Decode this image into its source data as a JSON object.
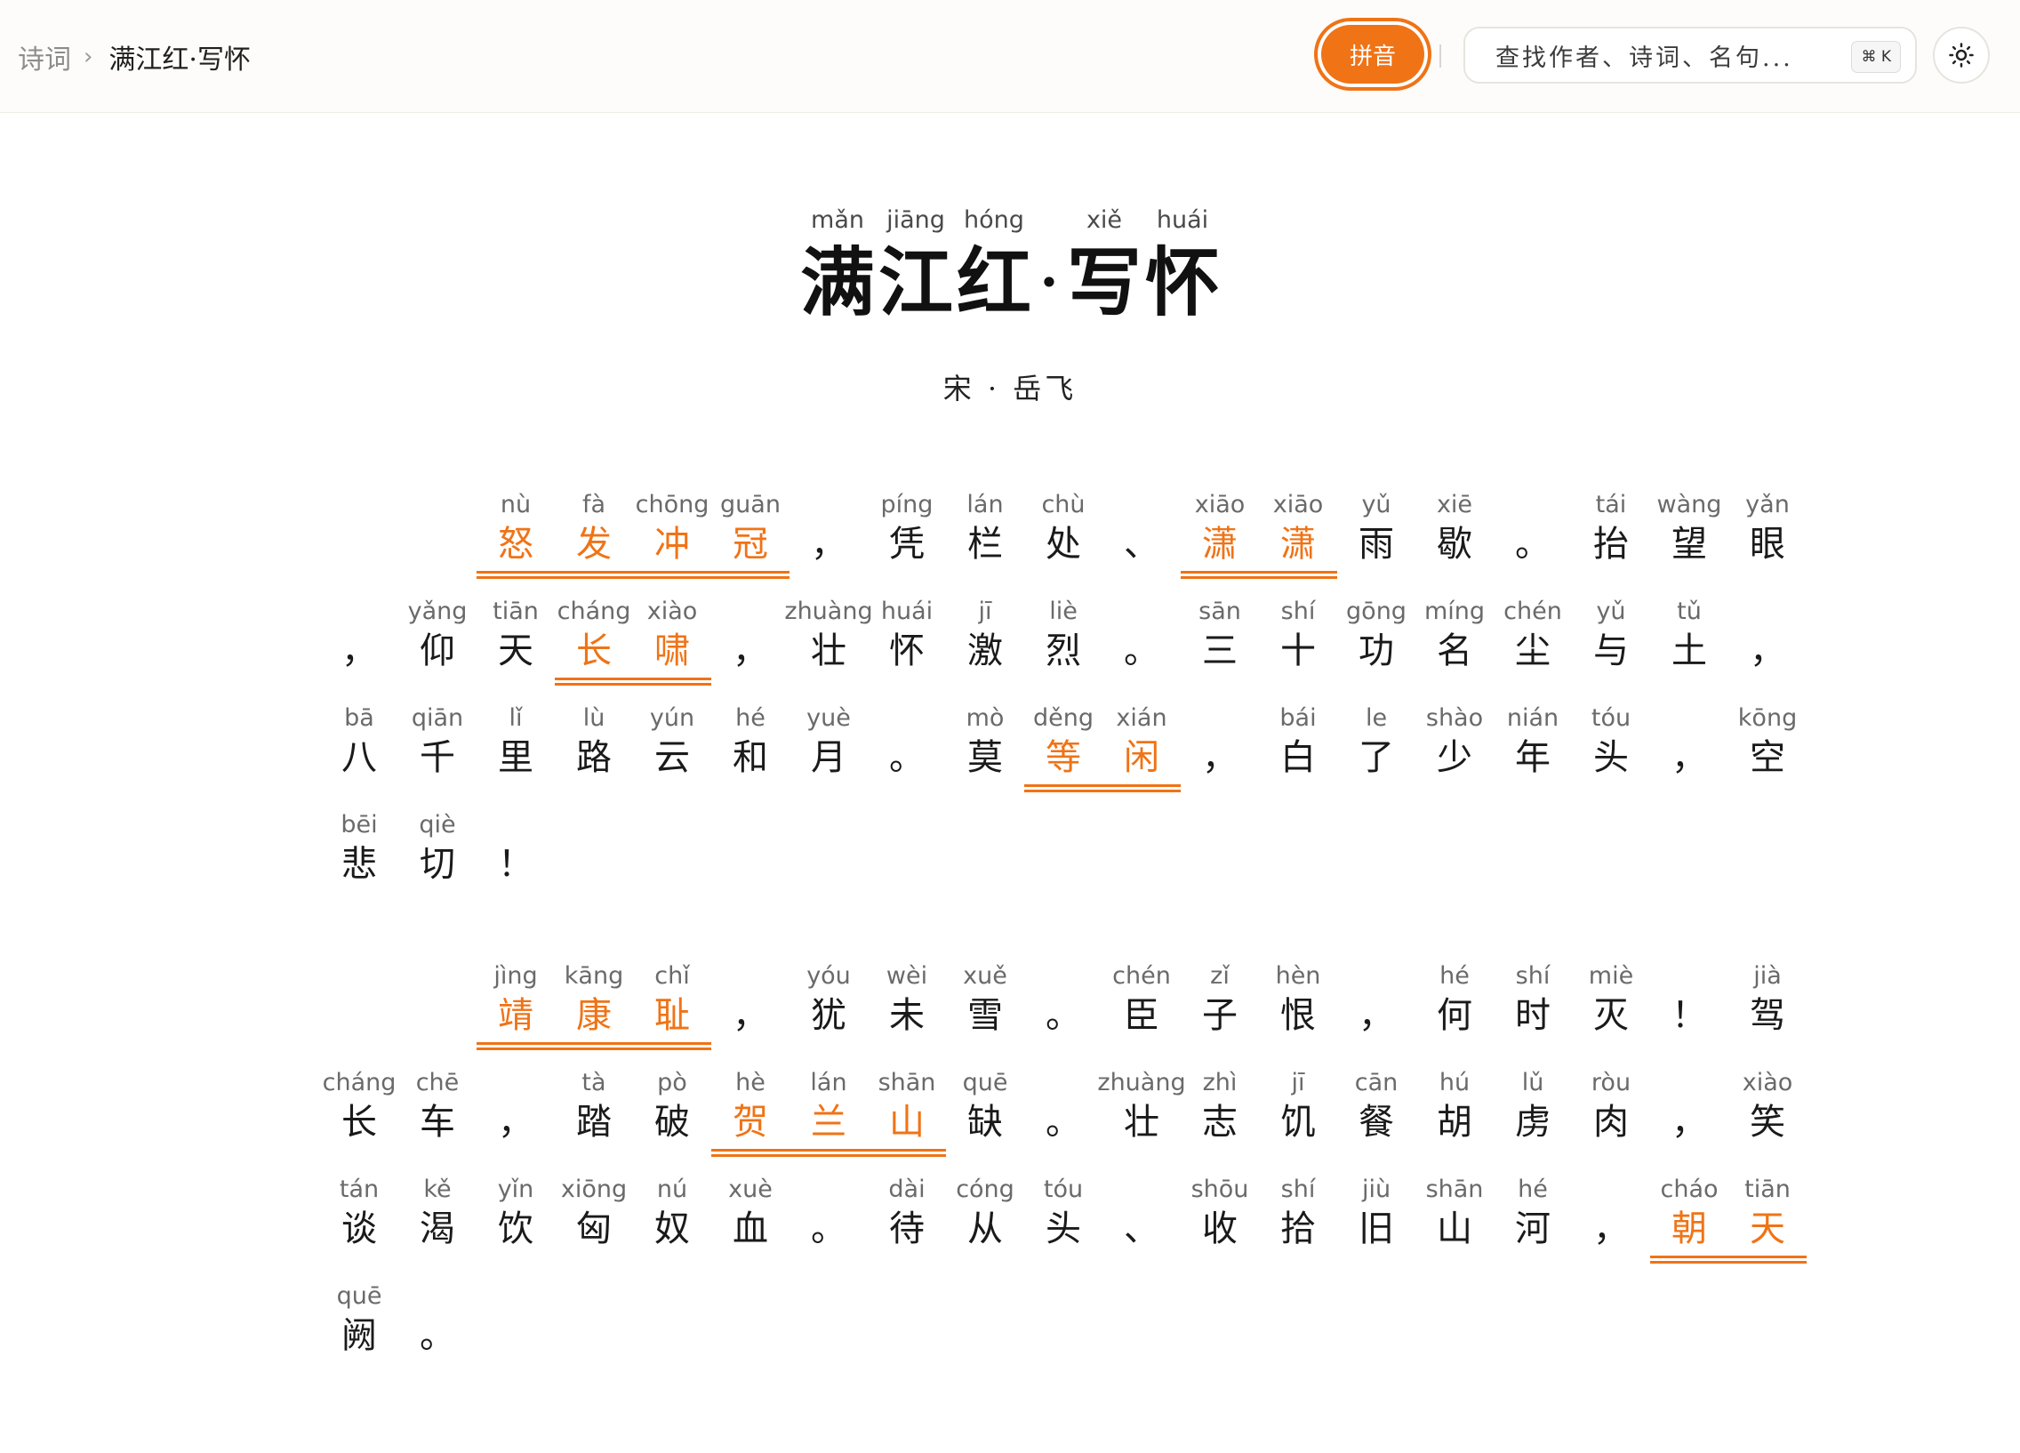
{
  "breadcrumb": {
    "root": "诗词",
    "current": "满江红·写怀"
  },
  "toolbar": {
    "pinyin_label": "拼音",
    "search_placeholder": "查找作者、诗词、名句...",
    "shortcut": "⌘ K"
  },
  "title": {
    "chars": [
      {
        "py": "mǎn",
        "hz": "满"
      },
      {
        "py": "jiāng",
        "hz": "江"
      },
      {
        "py": "hóng",
        "hz": "红"
      },
      {
        "py": "",
        "hz": "·"
      },
      {
        "py": "xiě",
        "hz": "写"
      },
      {
        "py": "huái",
        "hz": "怀"
      }
    ]
  },
  "author": "宋 · 岳飞",
  "accent_color": "#f07316",
  "poem_lines": [
    [
      [
        "怒",
        "nù",
        1
      ],
      [
        "发",
        "fà",
        1
      ],
      [
        "冲",
        "chōng",
        1
      ],
      [
        "冠",
        "guān",
        1
      ],
      [
        "，",
        "",
        0
      ],
      [
        "凭",
        "píng",
        0
      ],
      [
        "栏",
        "lán",
        0
      ],
      [
        "处",
        "chù",
        0
      ],
      [
        "、",
        "",
        0
      ],
      [
        "潇",
        "xiāo",
        1
      ],
      [
        "潇",
        "xiāo",
        1
      ],
      [
        "雨",
        "yǔ",
        0
      ],
      [
        "歇",
        "xiē",
        0
      ],
      [
        "。",
        "",
        0
      ],
      [
        "抬",
        "tái",
        0
      ],
      [
        "望",
        "wàng",
        0
      ],
      [
        "眼",
        "yǎn",
        0
      ]
    ],
    [
      [
        "，",
        "",
        0
      ],
      [
        "仰",
        "yǎng",
        0
      ],
      [
        "天",
        "tiān",
        0
      ],
      [
        "长",
        "cháng",
        1
      ],
      [
        "啸",
        "xiào",
        1
      ],
      [
        "，",
        "",
        0
      ],
      [
        "壮",
        "zhuàng",
        0
      ],
      [
        "怀",
        "huái",
        0
      ],
      [
        "激",
        "jī",
        0
      ],
      [
        "烈",
        "liè",
        0
      ],
      [
        "。",
        "",
        0
      ],
      [
        "三",
        "sān",
        0
      ],
      [
        "十",
        "shí",
        0
      ],
      [
        "功",
        "gōng",
        0
      ],
      [
        "名",
        "míng",
        0
      ],
      [
        "尘",
        "chén",
        0
      ],
      [
        "与",
        "yǔ",
        0
      ],
      [
        "土",
        "tǔ",
        0
      ],
      [
        "，",
        "",
        0
      ]
    ],
    [
      [
        "八",
        "bā",
        0
      ],
      [
        "千",
        "qiān",
        0
      ],
      [
        "里",
        "lǐ",
        0
      ],
      [
        "路",
        "lù",
        0
      ],
      [
        "云",
        "yún",
        0
      ],
      [
        "和",
        "hé",
        0
      ],
      [
        "月",
        "yuè",
        0
      ],
      [
        "。",
        "",
        0
      ],
      [
        "莫",
        "mò",
        0
      ],
      [
        "等",
        "děng",
        1
      ],
      [
        "闲",
        "xián",
        1
      ],
      [
        "，",
        "",
        0
      ],
      [
        "白",
        "bái",
        0
      ],
      [
        "了",
        "le",
        0
      ],
      [
        "少",
        "shào",
        0
      ],
      [
        "年",
        "nián",
        0
      ],
      [
        "头",
        "tóu",
        0
      ],
      [
        "，",
        "",
        0
      ],
      [
        "空",
        "kōng",
        0
      ]
    ],
    [
      [
        "悲",
        "bēi",
        0
      ],
      [
        "切",
        "qiè",
        0
      ],
      [
        "！",
        "",
        0
      ]
    ],
    [
      [
        "靖",
        "jìng",
        1
      ],
      [
        "康",
        "kāng",
        1
      ],
      [
        "耻",
        "chǐ",
        1
      ],
      [
        "，",
        "",
        0
      ],
      [
        "犹",
        "yóu",
        0
      ],
      [
        "未",
        "wèi",
        0
      ],
      [
        "雪",
        "xuě",
        0
      ],
      [
        "。",
        "",
        0
      ],
      [
        "臣",
        "chén",
        0
      ],
      [
        "子",
        "zǐ",
        0
      ],
      [
        "恨",
        "hèn",
        0
      ],
      [
        "，",
        "",
        0
      ],
      [
        "何",
        "hé",
        0
      ],
      [
        "时",
        "shí",
        0
      ],
      [
        "灭",
        "miè",
        0
      ],
      [
        "！",
        "",
        0
      ],
      [
        "驾",
        "jià",
        0
      ]
    ],
    [
      [
        "长",
        "cháng",
        0
      ],
      [
        "车",
        "chē",
        0
      ],
      [
        "，",
        "",
        0
      ],
      [
        "踏",
        "tà",
        0
      ],
      [
        "破",
        "pò",
        0
      ],
      [
        "贺",
        "hè",
        1
      ],
      [
        "兰",
        "lán",
        1
      ],
      [
        "山",
        "shān",
        1
      ],
      [
        "缺",
        "quē",
        0
      ],
      [
        "。",
        "",
        0
      ],
      [
        "壮",
        "zhuàng",
        0
      ],
      [
        "志",
        "zhì",
        0
      ],
      [
        "饥",
        "jī",
        0
      ],
      [
        "餐",
        "cān",
        0
      ],
      [
        "胡",
        "hú",
        0
      ],
      [
        "虏",
        "lǔ",
        0
      ],
      [
        "肉",
        "ròu",
        0
      ],
      [
        "，",
        "",
        0
      ],
      [
        "笑",
        "xiào",
        0
      ]
    ],
    [
      [
        "谈",
        "tán",
        0
      ],
      [
        "渴",
        "kě",
        0
      ],
      [
        "饮",
        "yǐn",
        0
      ],
      [
        "匈",
        "xiōng",
        0
      ],
      [
        "奴",
        "nú",
        0
      ],
      [
        "血",
        "xuè",
        0
      ],
      [
        "。",
        "",
        0
      ],
      [
        "待",
        "dài",
        0
      ],
      [
        "从",
        "cóng",
        0
      ],
      [
        "头",
        "tóu",
        0
      ],
      [
        "、",
        "",
        0
      ],
      [
        "收",
        "shōu",
        0
      ],
      [
        "拾",
        "shí",
        0
      ],
      [
        "旧",
        "jiù",
        0
      ],
      [
        "山",
        "shān",
        0
      ],
      [
        "河",
        "hé",
        0
      ],
      [
        "，",
        "",
        0
      ],
      [
        "朝",
        "cháo",
        1
      ],
      [
        "天",
        "tiān",
        1
      ]
    ],
    [
      [
        "阙",
        "quē",
        0
      ],
      [
        "。",
        "",
        0
      ]
    ]
  ]
}
